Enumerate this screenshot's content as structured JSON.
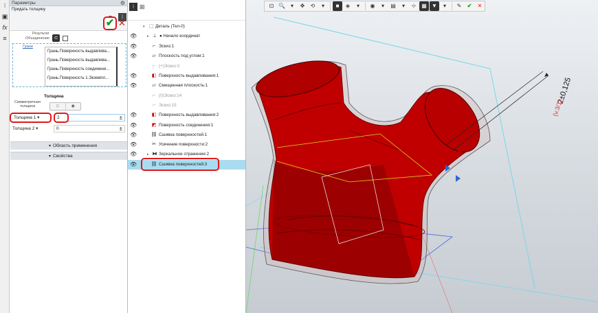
{
  "params_panel": {
    "title": "Параметры",
    "command_name": "Придать толщину",
    "help_icon": "?",
    "result_label_line1": "Результат",
    "result_label_line2": "Объединение",
    "faces_link": "Грани",
    "faces": [
      "Грань.Поверхность выдавлива...",
      "Грань.Поверхность выдавлива...",
      "Грань.Поверхность соединени...",
      "Грань.Поверхность 1.Экземпл..."
    ],
    "thickness_title": "Толщина",
    "symmetric_line1": "Симметричная",
    "symmetric_line2": "толщина",
    "thickness1_label": "Толщина 1",
    "thickness1_value": "2",
    "thickness2_label": "Толщина 2",
    "thickness2_value": "0",
    "section_scope": "Область применения",
    "section_props": "Свойства",
    "ok_icon": "✔",
    "cancel_icon": "✕"
  },
  "tree": {
    "root": "Деталь (Тел-0)",
    "items": [
      {
        "label": "Начало координат",
        "gray": false
      },
      {
        "label": "Эскиз:1",
        "gray": false
      },
      {
        "label": "Плоскость под углом:1",
        "gray": false
      },
      {
        "label": "(+)Эскиз:3",
        "gray": true
      },
      {
        "label": "Поверхность выдавливания:1",
        "gray": false
      },
      {
        "label": "Смещенная плоскость:1",
        "gray": false
      },
      {
        "label": "(0)Эскиз:14",
        "gray": true
      },
      {
        "label": "Эскиз:15",
        "gray": true
      },
      {
        "label": "Поверхность выдавливания:2",
        "gray": false
      },
      {
        "label": "Поверхность соединения:1",
        "gray": false
      },
      {
        "label": "Сшивка поверхностей:1",
        "gray": false
      },
      {
        "label": "Усечение поверхности:2",
        "gray": false
      },
      {
        "label": "Зеркальное отражение:2",
        "gray": false
      },
      {
        "label": "Сшивка поверхностей:3",
        "gray": false
      }
    ]
  },
  "viewport": {
    "dimension_text": "2±0,125",
    "dimension_sub": "(v.3/1)"
  },
  "colors": {
    "body_red": "#c00000",
    "accent_red": "#e01818",
    "selection_blue": "#a9dcf0",
    "ok_green": "#1a9a2a"
  }
}
